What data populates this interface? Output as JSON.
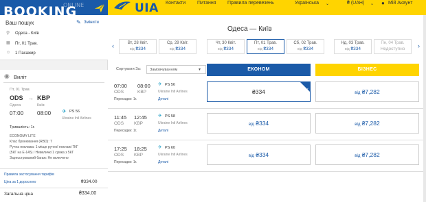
{
  "header": {
    "booking_text": "BOOKING",
    "online_text": "ONLINE",
    "brand": "UIA",
    "nav": [
      "Контакти",
      "Питання",
      "Правила перевезень"
    ],
    "language": "Українська",
    "currency": "₴ (UAH)",
    "account": "Мій Акаунт"
  },
  "search": {
    "title": "Ваш пошук",
    "change_label": "Змінити",
    "route": "Одеса - Київ",
    "date": "Пт, 01 Трав.",
    "passengers": "1 Пасажир"
  },
  "flight_summary": {
    "section_title": "Виліт",
    "date": "Пт, 01 Трав.",
    "from_code": "ODS",
    "to_code": "KBP",
    "from_city": "Одеса",
    "to_city": "Київ",
    "dep_time": "07:00",
    "arr_time": "08:00",
    "flight_no": "PS 56",
    "airline": "Ukraine Intl Airlines",
    "duration": "Тривалість: 1г.",
    "fare_name": "ECONOMY LITE",
    "booking_class": "Клас бронювання (RBD):  T",
    "hand_baggage": "Ручна поклажа: 1 місце ручної поклажі 7КГ",
    "hand_baggage_2": "(5КГ на E-145) / Невеличкі 1 сумка з 5КГ",
    "checked_baggage": "Зареєстрований багаж: Не включено",
    "fare_rules_link": "Правила застосування тарифів",
    "price_label": "Ціна за 1 дорослого",
    "price_value": "₴334.00",
    "total_label": "Загальна ціна",
    "total_value": "₴334.00"
  },
  "main": {
    "route_title": "Одеса — Київ",
    "dates": [
      {
        "day": "Вт, 28 Квіт.",
        "price_prefix": "від",
        "price": "₴334"
      },
      {
        "day": "Ср, 29 Квіт.",
        "price_prefix": "від",
        "price": "₴334"
      },
      {
        "day": "Чт, 30 Квіт.",
        "price_prefix": "від",
        "price": "₴334"
      },
      {
        "day": "Пт, 01 Трав.",
        "price_prefix": "від",
        "price": "₴334"
      },
      {
        "day": "Сб, 02 Трав.",
        "price_prefix": "від",
        "price": "₴334"
      },
      {
        "day": "Нд, 03 Трав.",
        "price_prefix": "від",
        "price": "₴334"
      },
      {
        "day": "Пн, 04 Трав.",
        "price_prefix": "",
        "price": "Недоступно"
      }
    ],
    "sort_label": "Сортувати За:",
    "sort_value": "Замовчуванням",
    "economy_label": "ЕКОНОМ",
    "business_label": "БІЗНЕС",
    "flights": [
      {
        "dep": "07:00",
        "arr": "08:00",
        "from": "ODS",
        "to": "KBP",
        "flight": "PS 56",
        "airline": "Ukraine Intl Airlines",
        "transfers": "Пересадки: 1г.",
        "details": "Деталі",
        "eco_prefix": "",
        "eco_price": "₴334",
        "biz_prefix": "від",
        "biz_price": "₴7,282"
      },
      {
        "dep": "11:45",
        "arr": "12:45",
        "from": "ODS",
        "to": "KBP",
        "flight": "PS 58",
        "airline": "Ukraine Intl Airlines",
        "transfers": "Пересадки: 1г.",
        "details": "Деталі",
        "eco_prefix": "від",
        "eco_price": "₴334",
        "biz_prefix": "від",
        "biz_price": "₴7,282"
      },
      {
        "dep": "17:25",
        "arr": "18:25",
        "from": "ODS",
        "to": "KBP",
        "flight": "PS 60",
        "airline": "Ukraine Intl Airlines",
        "transfers": "Пересадки: 1г.",
        "details": "Деталі",
        "eco_prefix": "від",
        "eco_price": "₴334",
        "biz_prefix": "від",
        "biz_price": "₴7,282"
      }
    ]
  },
  "colors": {
    "accent_blue": "#1a5aa8",
    "brand_yellow": "#ffd400"
  }
}
